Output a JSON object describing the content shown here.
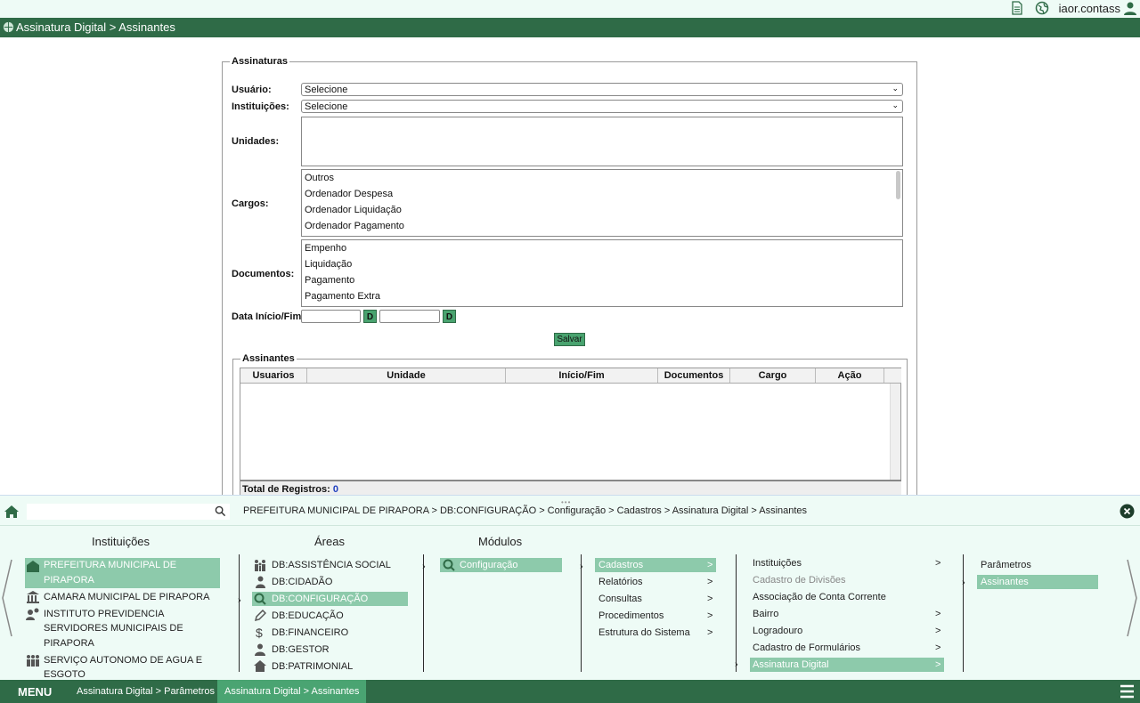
{
  "topbar": {
    "user": "iaor.contass",
    "icons": [
      "document-icon",
      "globe-icon",
      "user-icon"
    ]
  },
  "titlebar": {
    "title": "Assinatura Digital > Assinantes",
    "controls": [
      "help-icon",
      "gear-icon",
      "minimize-icon",
      "restore-icon",
      "close-icon"
    ]
  },
  "form": {
    "legend": "Assinaturas",
    "usuario_label": "Usuário:",
    "usuario_value": "Selecione",
    "instituicoes_label": "Instituições:",
    "instituicoes_value": "Selecione",
    "unidades_label": "Unidades:",
    "cargos_label": "Cargos:",
    "cargos": [
      "Outros",
      "Ordenador Despesa",
      "Ordenador Liquidação",
      "Ordenador Pagamento"
    ],
    "documentos_label": "Documentos:",
    "documentos": [
      "Empenho",
      "Liquidação",
      "Pagamento",
      "Pagamento Extra"
    ],
    "data_label": "Data Início/Fim:",
    "date_btn": "D",
    "salvar": "Salvar"
  },
  "assinantes": {
    "legend": "Assinantes",
    "columns": [
      "Usuarios",
      "Unidade",
      "Início/Fim",
      "Documentos",
      "Cargo",
      "Ação"
    ],
    "total_label": "Total de Registros:",
    "total_value": "0"
  },
  "panel": {
    "breadcrumb": "PREFEITURA MUNICIPAL DE PIRAPORA > DB:CONFIGURAÇÃO > Configuração > Cadastros > Assinatura Digital > Assinantes",
    "headers": {
      "instituicoes": "Instituições",
      "areas": "Áreas",
      "modulos": "Módulos"
    },
    "instituicoes": [
      "PREFEITURA MUNICIPAL DE",
      "PIRAPORA",
      "CAMARA MUNICIPAL DE PIRAPORA",
      "INSTITUTO PREVIDENCIA",
      "SERVIDORES MUNICIPAIS DE",
      "PIRAPORA",
      "SERVIÇO AUTONOMO DE AGUA E",
      "ESGOTO"
    ],
    "areas": [
      "DB:ASSISTÊNCIA SOCIAL",
      "DB:CIDADÃO",
      "DB:CONFIGURAÇÃO",
      "DB:EDUCAÇÃO",
      "DB:FINANCEIRO",
      "DB:GESTOR",
      "DB:PATRIMONIAL"
    ],
    "modulos": [
      "Configuração"
    ],
    "menu1": [
      "Cadastros",
      "Relatórios",
      "Consultas",
      "Procedimentos",
      "Estrutura do Sistema"
    ],
    "menu2": [
      "Instituições",
      "Cadastro de Divisões",
      "Associação de Conta Corrente",
      "Bairro",
      "Logradouro",
      "Cadastro de Formulários",
      "Assinatura Digital"
    ],
    "menu3": [
      "Parâmetros",
      "Assinantes"
    ],
    "arrow": ">"
  },
  "bottombar": {
    "menu": "MENU",
    "tabs": [
      "Assinatura Digital > Parâmetros",
      "Assinatura Digital > Assinantes"
    ]
  },
  "colors": {
    "green_dark": "#2f6b47",
    "green_btn": "#49a36f",
    "selected": "#8dcaab",
    "panel_bg": "#eefbf6"
  }
}
